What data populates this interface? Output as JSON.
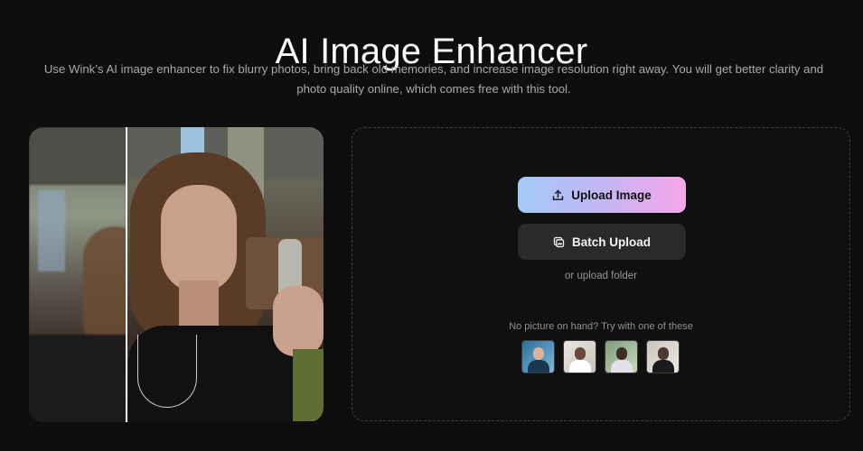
{
  "header": {
    "title": "AI Image Enhancer",
    "subtitle": "Use Wink’s AI image enhancer to fix blurry photos, bring back old memories, and increase image resolution right away. You will get better clarity and photo quality online, which comes free with this tool."
  },
  "uploader": {
    "upload_label": "Upload Image",
    "batch_label": "Batch Upload",
    "folder_label": "or upload folder",
    "try_label": "No picture on hand? Try with one of these",
    "samples": [
      "sample-1",
      "sample-2",
      "sample-3",
      "sample-4"
    ]
  },
  "icons": {
    "upload": "upload-icon",
    "batch": "batch-upload-icon"
  },
  "colors": {
    "background": "#0e0e0f",
    "upload_gradient_start": "#a3c9f8",
    "upload_gradient_end": "#f4a7e8",
    "batch_button": "#2a2a2d"
  }
}
